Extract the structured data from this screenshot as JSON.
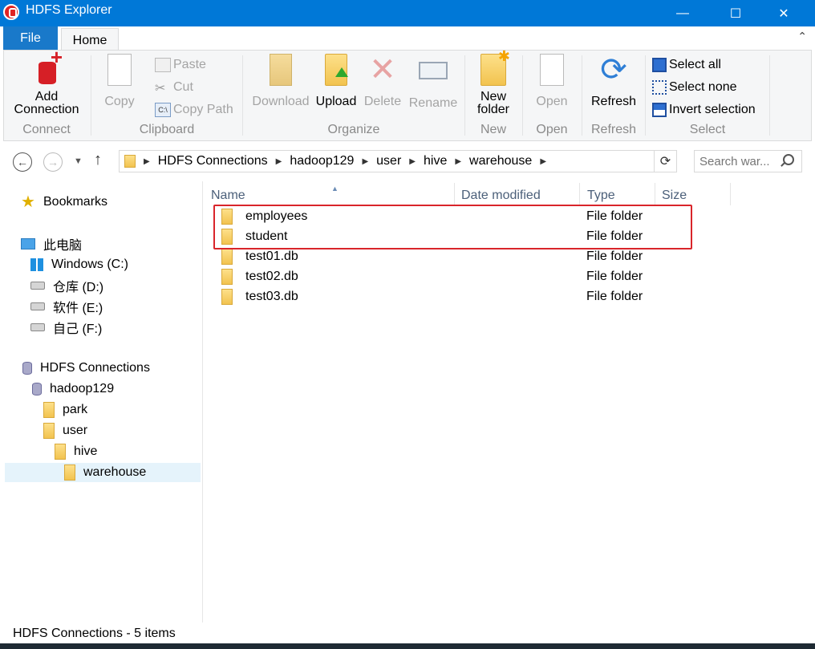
{
  "window": {
    "title": "HDFS Explorer"
  },
  "tabs": {
    "file": "File",
    "home": "Home"
  },
  "ribbon": {
    "connect": {
      "label": "Connect",
      "add_connection_line1": "Add",
      "add_connection_line2": "Connection"
    },
    "clipboard": {
      "label": "Clipboard",
      "copy": "Copy",
      "paste": "Paste",
      "cut": "Cut",
      "copy_path": "Copy Path"
    },
    "organize": {
      "label": "Organize",
      "download": "Download",
      "upload": "Upload",
      "delete": "Delete",
      "rename": "Rename"
    },
    "new": {
      "label": "New",
      "new_folder_line1": "New",
      "new_folder_line2": "folder"
    },
    "open": {
      "label": "Open",
      "open": "Open"
    },
    "refresh": {
      "label": "Refresh",
      "refresh": "Refresh"
    },
    "select": {
      "label": "Select",
      "select_all": "Select all",
      "select_none": "Select none",
      "invert_selection": "Invert selection"
    }
  },
  "address": {
    "crumbs": [
      "HDFS Connections",
      "hadoop129",
      "user",
      "hive",
      "warehouse"
    ],
    "search_placeholder": "Search war..."
  },
  "navpane": {
    "bookmarks": "Bookmarks",
    "this_pc": "此电脑",
    "drives": [
      "Windows (C:)",
      "仓库 (D:)",
      "软件 (E:)",
      "自己 (F:)"
    ],
    "hdfs_connections": "HDFS Connections",
    "host": "hadoop129",
    "folders": {
      "park": "park",
      "user": "user",
      "hive": "hive",
      "warehouse": "warehouse"
    }
  },
  "filelist": {
    "columns": {
      "name": "Name",
      "date_modified": "Date modified",
      "type": "Type",
      "size": "Size"
    },
    "rows": [
      {
        "name": "employees",
        "type": "File folder"
      },
      {
        "name": "student",
        "type": "File folder"
      },
      {
        "name": "test01.db",
        "type": "File folder"
      },
      {
        "name": "test02.db",
        "type": "File folder"
      },
      {
        "name": "test03.db",
        "type": "File folder"
      }
    ]
  },
  "status": {
    "text": "HDFS Connections - 5 items"
  }
}
